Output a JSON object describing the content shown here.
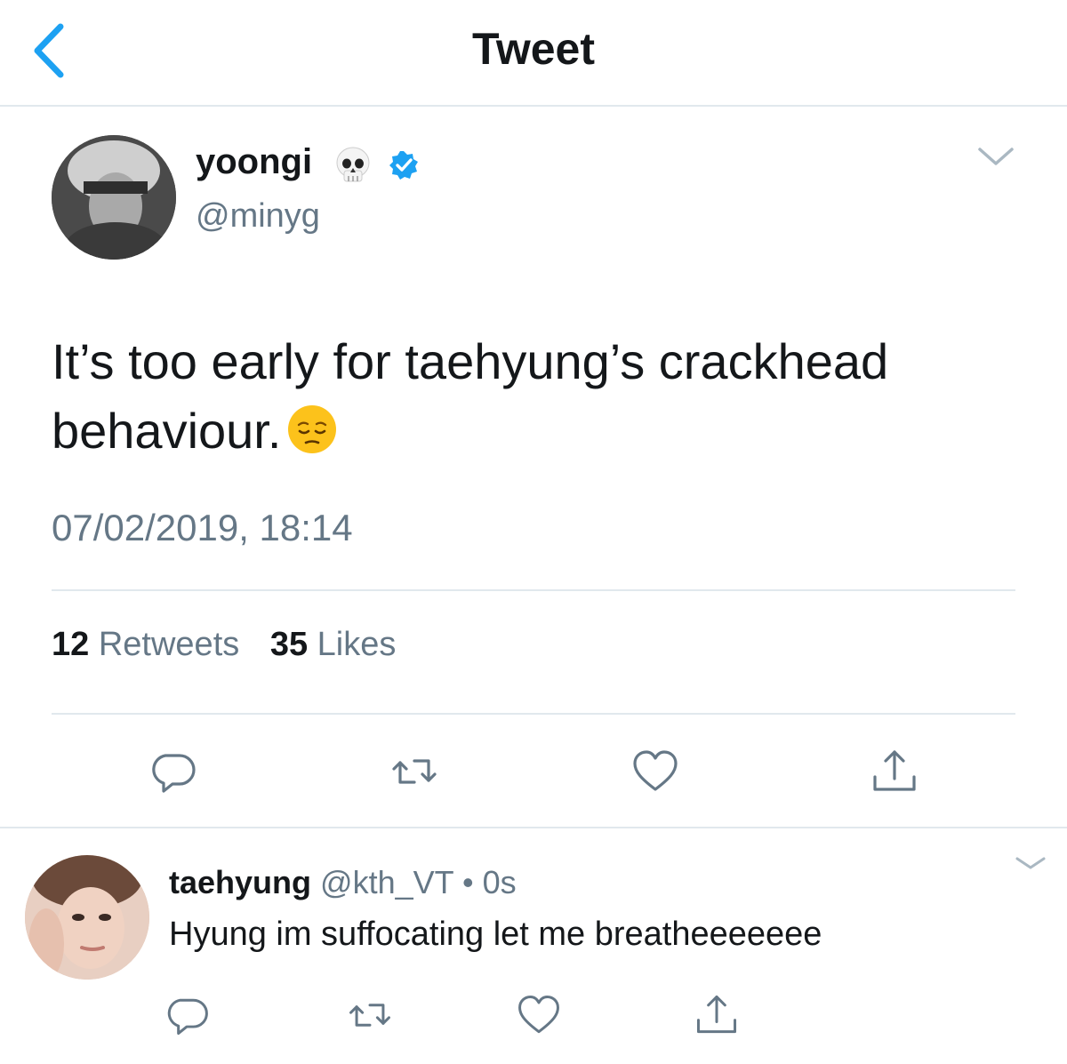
{
  "header": {
    "title": "Tweet",
    "back_icon": "chevron-left-icon"
  },
  "tweet": {
    "display_name": "yoongi",
    "name_emoji": "skull-emoji",
    "verified": true,
    "handle": "@minyg",
    "text": "It’s too early for taehyung’s crackhead behaviour.",
    "text_emoji": "pensive-face-emoji",
    "timestamp": "07/02/2019, 18:14",
    "retweets_count": "12",
    "retweets_label": "Retweets",
    "likes_count": "35",
    "likes_label": "Likes"
  },
  "reply": {
    "display_name": "taehyung",
    "handle": "@kth_VT",
    "separator": "•",
    "time": "0s",
    "text": "Hyung im suffocating let me breatheeeeeee"
  },
  "colors": {
    "accent": "#1da1f2",
    "text_primary": "#14171a",
    "text_secondary": "#657786",
    "divider": "#e1e8ed",
    "icon_gray": "#657786"
  }
}
